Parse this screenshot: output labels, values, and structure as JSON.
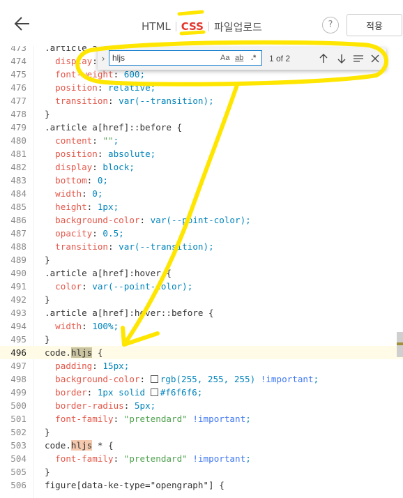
{
  "header": {
    "tabs": [
      {
        "label": "HTML",
        "active": false
      },
      {
        "label": "CSS",
        "active": true
      },
      {
        "label": "파일업로드",
        "active": false
      }
    ],
    "help_label": "?",
    "apply_label": "적용"
  },
  "find": {
    "value": "hljs",
    "match_case": "Aa",
    "whole_word": "ab",
    "regex": ".*",
    "count": "1 of 2",
    "toggle_icon": "›"
  },
  "code": {
    "current_line": 496,
    "lines": [
      {
        "n": "473",
        "t": ".article a {"
      },
      {
        "n": "474",
        "t": "  display: inline-block;"
      },
      {
        "n": "475",
        "t": "  font-weight: 600;"
      },
      {
        "n": "476",
        "t": "  position: relative;"
      },
      {
        "n": "477",
        "t": "  transition: var(--transition);"
      },
      {
        "n": "478",
        "t": "}"
      },
      {
        "n": "479",
        "t": ".article a[href]::before {"
      },
      {
        "n": "480",
        "t": "  content: \"\";"
      },
      {
        "n": "481",
        "t": "  position: absolute;"
      },
      {
        "n": "482",
        "t": "  display: block;"
      },
      {
        "n": "483",
        "t": "  bottom: 0;"
      },
      {
        "n": "484",
        "t": "  width: 0;"
      },
      {
        "n": "485",
        "t": "  height: 1px;"
      },
      {
        "n": "486",
        "t": "  background-color: var(--point-color);"
      },
      {
        "n": "487",
        "t": "  opacity: 0.5;"
      },
      {
        "n": "488",
        "t": "  transition: var(--transition);"
      },
      {
        "n": "489",
        "t": "}"
      },
      {
        "n": "490",
        "t": ".article a[href]:hover {"
      },
      {
        "n": "491",
        "t": "  color: var(--point-color);"
      },
      {
        "n": "492",
        "t": "}"
      },
      {
        "n": "493",
        "t": ".article a[href]:hover::before {"
      },
      {
        "n": "494",
        "t": "  width: 100%;"
      },
      {
        "n": "495",
        "t": "}"
      },
      {
        "n": "496",
        "t": "code.hljs {"
      },
      {
        "n": "497",
        "t": "  padding: 15px;"
      },
      {
        "n": "498",
        "t": "  background-color: rgb(255, 255, 255) !important;"
      },
      {
        "n": "499",
        "t": "  border: 1px solid #f6f6f6;"
      },
      {
        "n": "500",
        "t": "  border-radius: 5px;"
      },
      {
        "n": "501",
        "t": "  font-family: \"pretendard\" !important;"
      },
      {
        "n": "502",
        "t": "}"
      },
      {
        "n": "503",
        "t": "code.hljs * {"
      },
      {
        "n": "504",
        "t": "  font-family: \"pretendard\" !important;"
      },
      {
        "n": "505",
        "t": "}"
      },
      {
        "n": "506",
        "t": "figure[data-ke-type=\"opengraph\"] {"
      }
    ]
  },
  "colors": {
    "active_tab": "#e5352b",
    "annotation": "#ffe600",
    "match_highlight": "#c9c3a0",
    "other_match": "#f5c9ad"
  }
}
